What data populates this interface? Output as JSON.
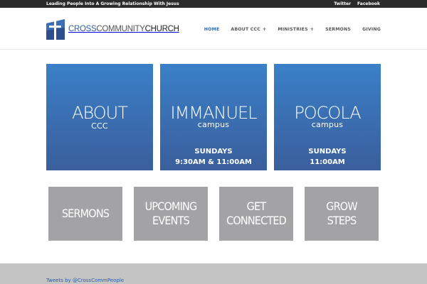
{
  "topbar": {
    "tagline": "Leading People Into A Growing Relationship With Jesus",
    "links": [
      "Twitter",
      "Facebook"
    ]
  },
  "logo": {
    "part1": "CROSS",
    "part2": "COMMUNITY",
    "part3": "CHURCH"
  },
  "nav": {
    "items": [
      {
        "label": "HOME",
        "active": true,
        "expandable": false
      },
      {
        "label": "ABOUT CCC",
        "active": false,
        "expandable": true
      },
      {
        "label": "MINISTRIES",
        "active": false,
        "expandable": true
      },
      {
        "label": "SERMONS",
        "active": false,
        "expandable": false
      },
      {
        "label": "GIVING",
        "active": false,
        "expandable": false
      }
    ],
    "plus": "+"
  },
  "tiles": {
    "about": {
      "title": "ABOUT",
      "subtitle": "CCC"
    },
    "immanuel": {
      "title": "IMMANUEL",
      "subtitle": "campus",
      "day": "SUNDAYS",
      "times": "9:30AM & 11:00AM"
    },
    "pocola": {
      "title": "POCOLA",
      "subtitle": "campus",
      "day": "SUNDAYS",
      "times": "11:00AM"
    }
  },
  "gray_tiles": [
    {
      "line1": "SERMONS",
      "line2": ""
    },
    {
      "line1": "UPCOMING",
      "line2": "EVENTS"
    },
    {
      "line1": "GET",
      "line2": "CONNECTED"
    },
    {
      "line1": "GROW",
      "line2": "STEPS"
    }
  ],
  "footer": {
    "tweets_link": "Tweets by @CrossCommPeople"
  },
  "colors": {
    "topbar": "#2b2b2b",
    "accent": "#2b6bb5",
    "tile_blue": "#3a6db0",
    "tile_gray": "#a3a3a5",
    "footer": "#c4c4c4"
  }
}
